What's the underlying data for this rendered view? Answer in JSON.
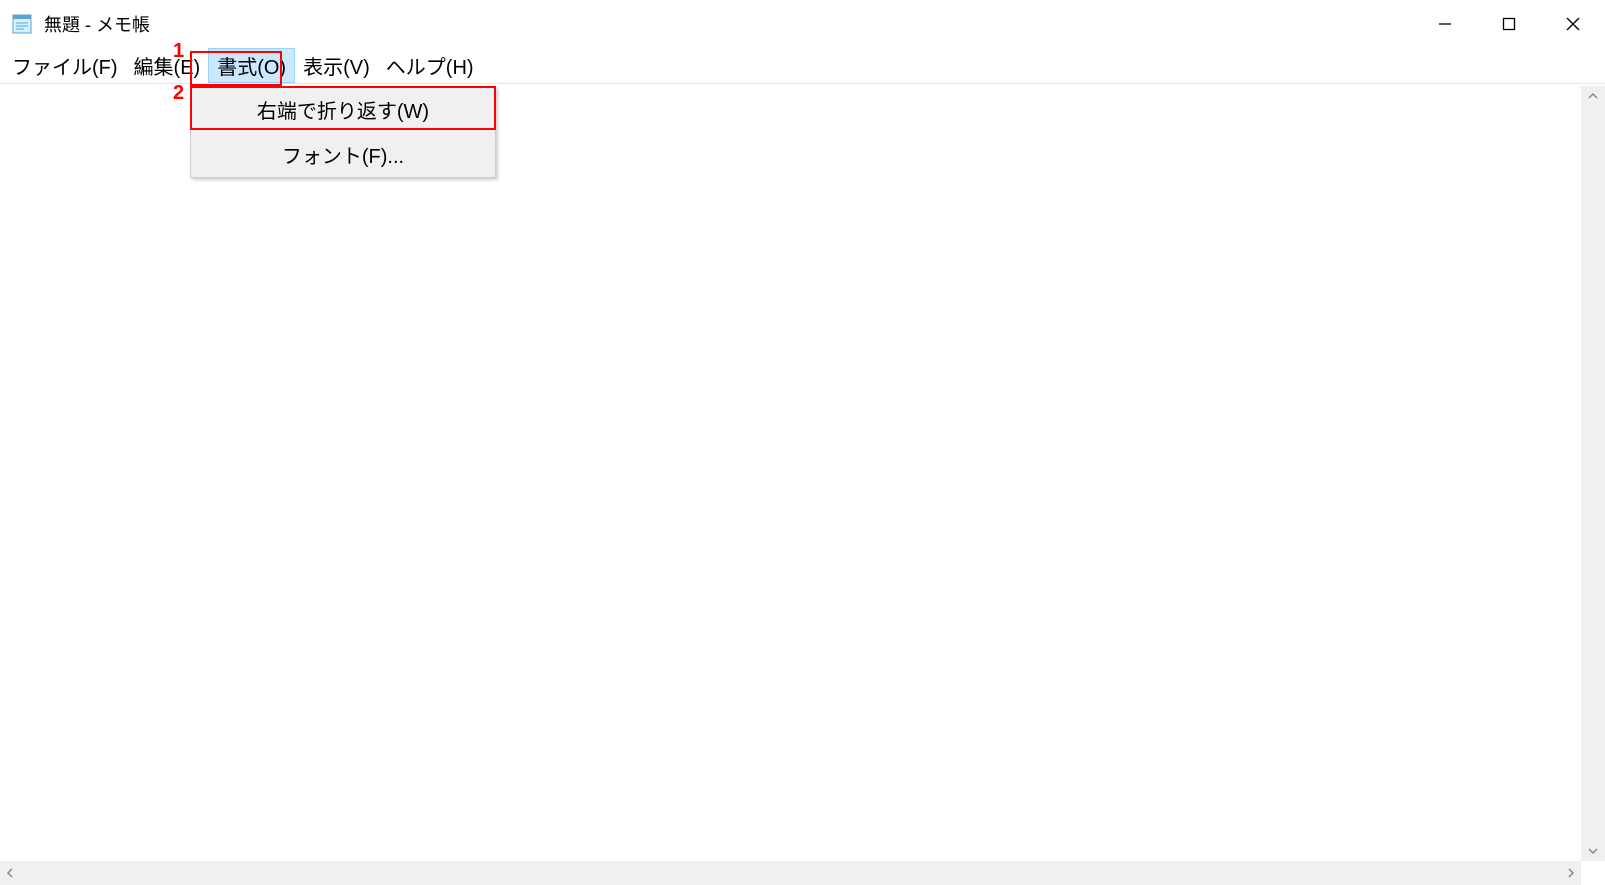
{
  "titlebar": {
    "title": "無題 - メモ帳"
  },
  "menubar": {
    "items": [
      {
        "label": "ファイル(F)",
        "selected": false
      },
      {
        "label": "編集(E)",
        "selected": false
      },
      {
        "label": "書式(O)",
        "selected": true
      },
      {
        "label": "表示(V)",
        "selected": false
      },
      {
        "label": "ヘルプ(H)",
        "selected": false
      }
    ]
  },
  "dropdown": {
    "items": [
      {
        "label": "右端で折り返す(W)"
      },
      {
        "label": "フォント(F)..."
      }
    ]
  },
  "annotations": {
    "marker1": "1",
    "marker2": "2"
  }
}
